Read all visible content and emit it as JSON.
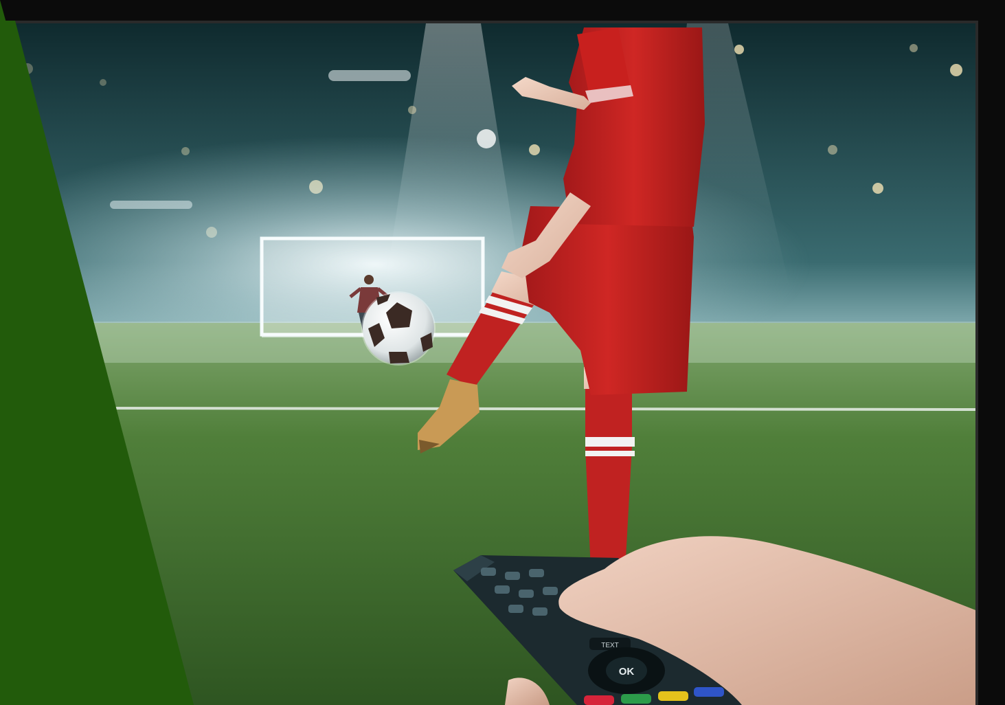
{
  "scene": {
    "remote_ok_label": "OK",
    "remote_text_label": "TEXT",
    "colors": {
      "green_panel": "#225b0b",
      "jersey_red": "#c8201e",
      "pitch_green": "#4e7f3a",
      "stadium_haze": "#b9d6da",
      "tv_frame": "#111111",
      "remote_body": "#1c2a2f",
      "remote_red": "#d6243a",
      "remote_green": "#2c9b4a",
      "remote_yellow": "#e4c21c",
      "remote_blue": "#2f55c8"
    },
    "icons": [
      "soccer-ball-icon",
      "remote-ok-button",
      "remote-color-buttons"
    ]
  }
}
